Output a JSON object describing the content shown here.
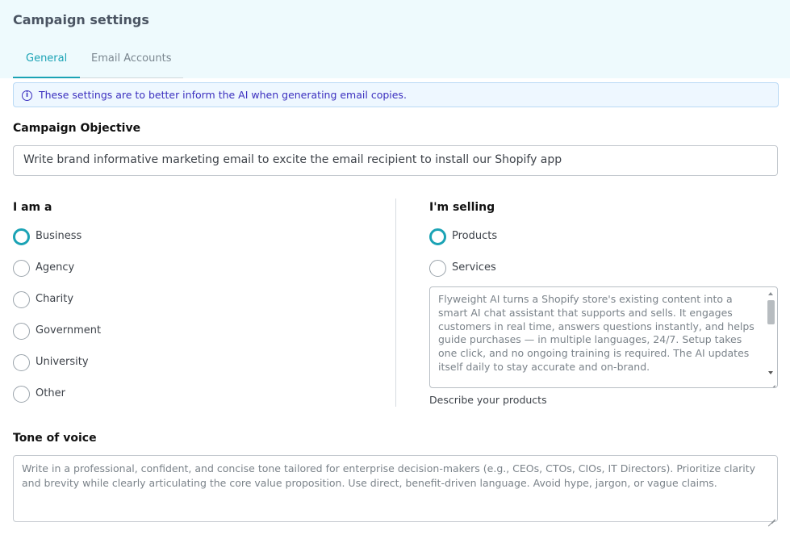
{
  "header": {
    "title": "Campaign settings",
    "tabs": [
      {
        "label": "General",
        "active": true
      },
      {
        "label": "Email Accounts",
        "active": false
      }
    ]
  },
  "info": {
    "icon": "info-icon",
    "text": "These settings are to better inform the AI when generating email copies."
  },
  "objective": {
    "label": "Campaign Objective",
    "value": "Write brand informative marketing email to excite the email recipient to install our Shopify app"
  },
  "i_am": {
    "label": "I am a",
    "options": [
      "Business",
      "Agency",
      "Charity",
      "Government",
      "University",
      "Other"
    ],
    "selected": "Business"
  },
  "selling": {
    "label": "I'm selling",
    "options": [
      "Products",
      "Services"
    ],
    "selected": "Products",
    "description": "Flyweight AI turns a Shopify store's existing content into a smart AI chat assistant that supports and sells. It engages customers in real time, answers questions instantly, and helps guide purchases — in multiple languages, 24/7. Setup takes one click, and no ongoing training is required. The AI updates itself daily to stay accurate and on-brand.",
    "helper": "Describe your products"
  },
  "tone": {
    "label": "Tone of voice",
    "value": "Write in a professional, confident, and concise tone tailored for enterprise decision-makers (e.g., CEOs, CTOs, CIOs, IT Directors). Prioritize clarity and brevity while clearly articulating the core value proposition. Use direct, benefit-driven language. Avoid hype, jargon, or vague claims."
  },
  "colors": {
    "accent": "#1ba3b5",
    "header_bg": "#eefafd",
    "info_text": "#3b2fbf",
    "info_bg": "#eef7ff"
  }
}
